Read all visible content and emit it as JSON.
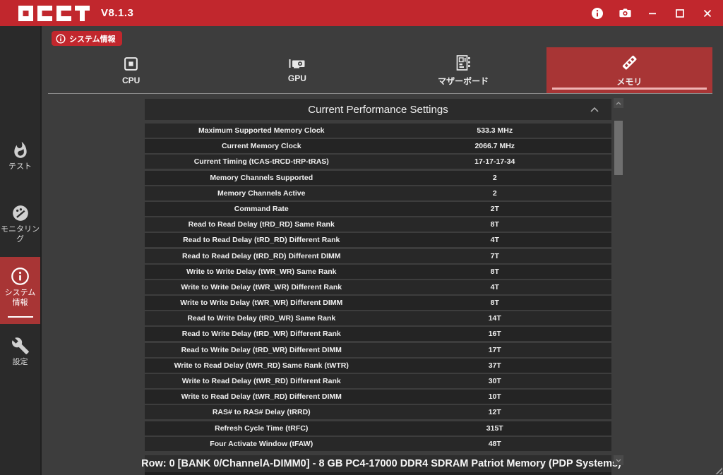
{
  "titlebar": {
    "app_name": "OCCT",
    "version": "V8.1.3"
  },
  "page_badge": {
    "label": "システム情報"
  },
  "sidebar": {
    "items": [
      {
        "id": "test",
        "label": "テスト"
      },
      {
        "id": "monitoring",
        "label": "モニタリング"
      },
      {
        "id": "system-info",
        "label": "システム情報",
        "selected": true
      },
      {
        "id": "settings",
        "label": "設定"
      }
    ]
  },
  "tabs": [
    {
      "id": "cpu",
      "label": "CPU"
    },
    {
      "id": "gpu",
      "label": "GPU"
    },
    {
      "id": "motherboard",
      "label": "マザーボード"
    },
    {
      "id": "memory",
      "label": "メモリ",
      "selected": true
    }
  ],
  "table": {
    "title": "Current Performance Settings",
    "rows": [
      {
        "label": "Maximum Supported Memory Clock",
        "value": "533.3 MHz"
      },
      {
        "label": "Current Memory Clock",
        "value": "2066.7 MHz"
      },
      {
        "label": "Current Timing (tCAS-tRCD-tRP-tRAS)",
        "value": "17-17-17-34"
      },
      {
        "label": "Memory Channels Supported",
        "value": "2"
      },
      {
        "label": "Memory Channels Active",
        "value": "2"
      },
      {
        "label": "Command Rate",
        "value": "2T"
      },
      {
        "label": "Read to Read Delay (tRD_RD) Same Rank",
        "value": "8T"
      },
      {
        "label": "Read to Read Delay (tRD_RD) Different Rank",
        "value": "4T"
      },
      {
        "label": "Read to Read Delay (tRD_RD) Different DIMM",
        "value": "7T"
      },
      {
        "label": "Write to Write Delay (tWR_WR) Same Rank",
        "value": "8T"
      },
      {
        "label": "Write to Write Delay (tWR_WR) Different Rank",
        "value": "4T"
      },
      {
        "label": "Write to Write Delay (tWR_WR) Different DIMM",
        "value": "8T"
      },
      {
        "label": "Read to Write Delay (tRD_WR) Same Rank",
        "value": "14T"
      },
      {
        "label": "Read to Write Delay (tRD_WR) Different Rank",
        "value": "16T"
      },
      {
        "label": "Read to Write Delay (tRD_WR) Different DIMM",
        "value": "17T"
      },
      {
        "label": "Write to Read Delay (tWR_RD) Same Rank (tWTR)",
        "value": "37T"
      },
      {
        "label": "Write to Read Delay (tWR_RD) Different Rank",
        "value": "30T"
      },
      {
        "label": "Write to Read Delay (tWR_RD) Different DIMM",
        "value": "10T"
      },
      {
        "label": "RAS# to RAS# Delay (tRRD)",
        "value": "12T"
      },
      {
        "label": "Refresh Cycle Time (tRFC)",
        "value": "315T"
      },
      {
        "label": "Four Activate Window (tFAW)",
        "value": "48T"
      }
    ]
  },
  "footer": {
    "label": "Row: 0 [BANK 0/ChannelA-DIMM0] - 8 GB PC4-17000 DDR4 SDRAM Patriot Memory (PDP Systems)"
  },
  "colors": {
    "titlebar_red": "#c1272d",
    "selected_red": "#a83535",
    "tab_underline_pink": "#f0b3b3",
    "main_bg": "#3d3d3d",
    "sidebar_bg": "#2a2a2a",
    "row_bg": "#242424",
    "header_row_bg": "#2b2b2b"
  }
}
